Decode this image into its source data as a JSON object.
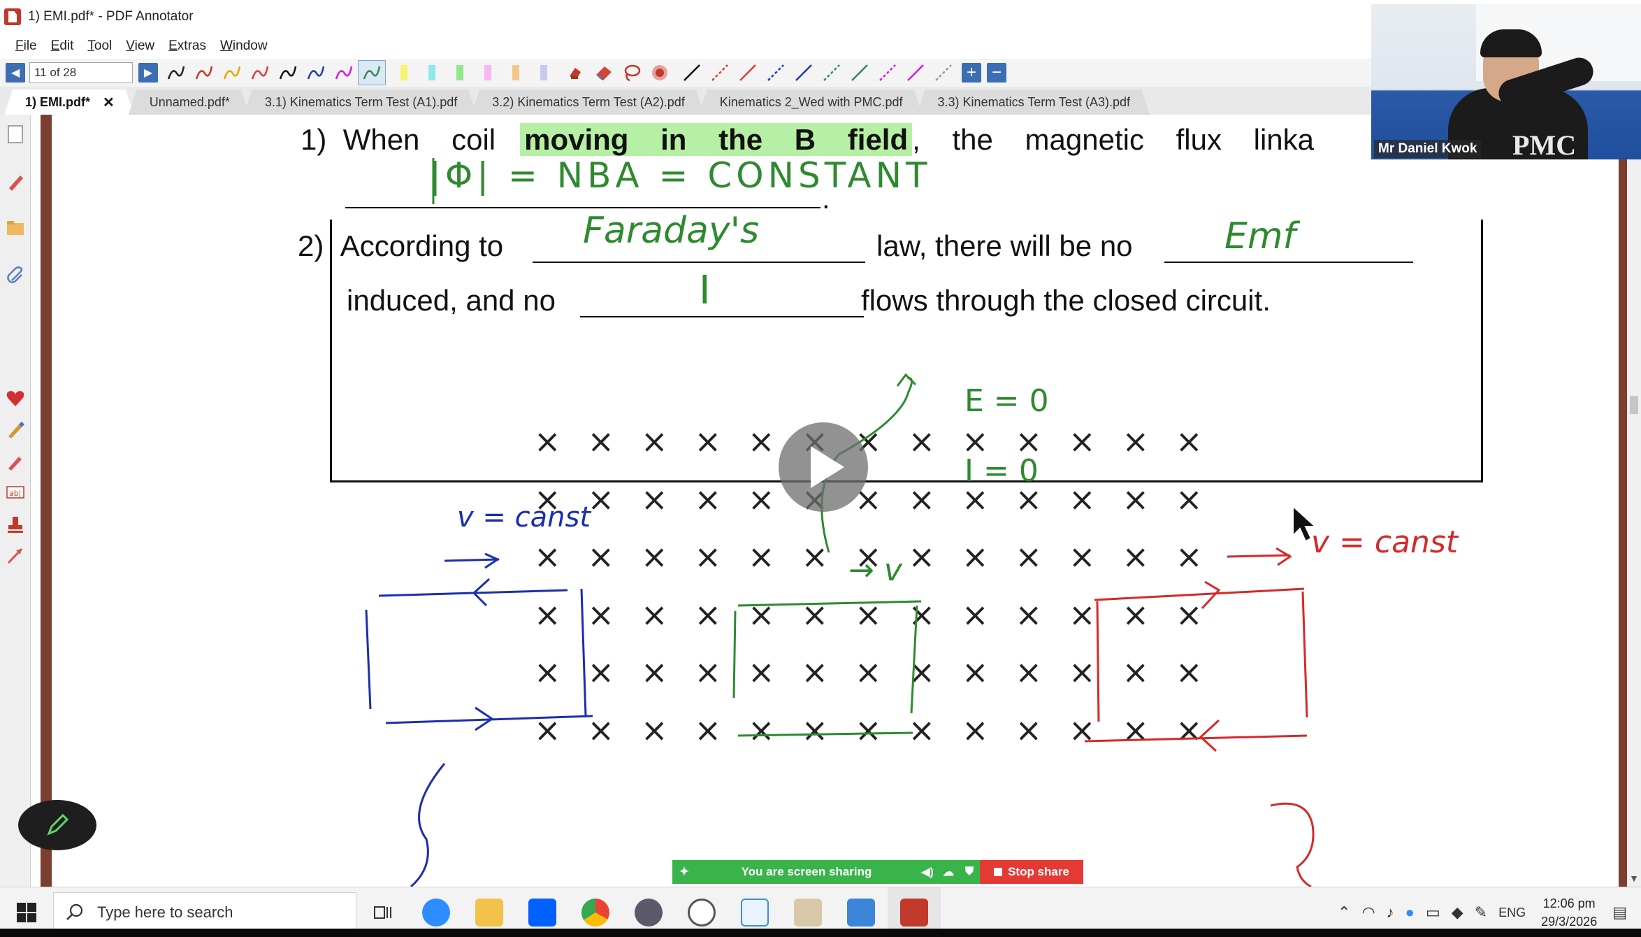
{
  "window": {
    "title": "1) EMI.pdf* - PDF Annotator"
  },
  "menu": {
    "items": [
      {
        "label_u": "F",
        "label_rest": "ile"
      },
      {
        "label_u": "E",
        "label_rest": "dit"
      },
      {
        "label_u": "T",
        "label_rest": "ool"
      },
      {
        "label_u": "V",
        "label_rest": "iew"
      },
      {
        "label_u": "E",
        "label_rest": "xtras"
      },
      {
        "label_u": "W",
        "label_rest": "indow"
      }
    ]
  },
  "toolbar": {
    "page_value": "11 of 28",
    "pen_colors": [
      "#222222",
      "#c0392b",
      "#e0a800",
      "#e53935",
      "#111111",
      "#1e3aa8",
      "#d81bd8",
      "#2e8b57"
    ],
    "highlighter_colors": [
      "#f7f56b",
      "#8fe8f0",
      "#8fe88f",
      "#f5b8f0",
      "#f5c68a",
      "#c8c8f5"
    ],
    "line_colors": [
      "#111111",
      "#e53935",
      "#e53935",
      "#1e3aa8",
      "#1e3aa8",
      "#2e8b57",
      "#2e8b57",
      "#d81bd8",
      "#d81bd8",
      "#999999"
    ]
  },
  "tabs": [
    {
      "label": "1) EMI.pdf*",
      "active": true,
      "close": "✕"
    },
    {
      "label": "Unnamed.pdf*"
    },
    {
      "label": "3.1) Kinematics Term Test (A1).pdf"
    },
    {
      "label": "3.2) Kinematics Term Test (A2).pdf"
    },
    {
      "label": "Kinematics 2_Wed with PMC.pdf"
    },
    {
      "label": "3.3) Kinematics Term Test (A3).pdf"
    }
  ],
  "document": {
    "q1": {
      "num": "1)",
      "pre": "When coil",
      "highlight": "moving in the B field",
      "post": ", the magnetic flux linka",
      "period": "."
    },
    "q2": {
      "num": "2)",
      "pre": "According to",
      "mid": "law, there will be no"
    },
    "q3": {
      "pre": "induced, and no",
      "post": "flows through the closed circuit."
    },
    "handwriting": {
      "flux": "|Φ| = NBA = CONSTANT",
      "faraday": "Faraday's",
      "emf": "Emf",
      "current": "I",
      "e_zero": "E = 0",
      "i_zero": "I = 0",
      "v_const_blue": "v = canst",
      "v_green": "→ v",
      "v_const_red": "v = canst"
    },
    "field_symbol": "×",
    "colors": {
      "blue": "#1a2fb0",
      "green": "#2f8a2f",
      "red": "#d42a2a",
      "highlight": "#b6f0a4"
    }
  },
  "webcam": {
    "name": "Mr Daniel Kwok",
    "shirt_logo": "PMC"
  },
  "screen_share": {
    "status": "You are screen sharing",
    "stop_label": "Stop share"
  },
  "taskbar": {
    "search_placeholder": "Type here to search",
    "apps": [
      "task-view",
      "zoom",
      "file-explorer",
      "dropbox",
      "chrome",
      "compass",
      "clock-app",
      "word-app",
      "installer",
      "paint",
      "pdf-annotator"
    ],
    "lang": "ENG",
    "time": "12:06 pm",
    "date": "29/3/2026"
  }
}
